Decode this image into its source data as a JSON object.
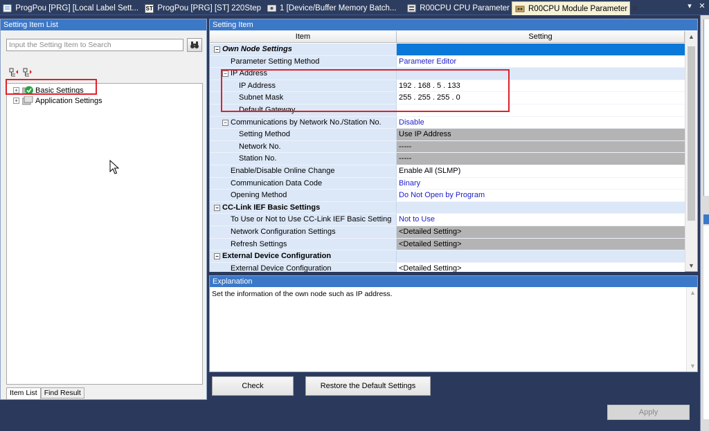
{
  "tabs": [
    {
      "label": "ProgPou [PRG] [Local Label Sett...",
      "icon": "ladder-program-icon"
    },
    {
      "label": "ProgPou [PRG] [ST] 220Step",
      "icon": "st-program-icon",
      "icon_text": "ST"
    },
    {
      "label": "1 [Device/Buffer Memory Batch...",
      "icon": "device-monitor-icon"
    },
    {
      "label": "R00CPU CPU Parameter",
      "icon": "parameter-icon"
    },
    {
      "label": "R00CPU Module Parameter",
      "icon": "module-parameter-icon",
      "active": true
    }
  ],
  "left_pane": {
    "title": "Setting Item List",
    "search_placeholder": "Input the Setting Item to Search",
    "tree": [
      {
        "label": "Basic Settings",
        "expander": "+"
      },
      {
        "label": "Application Settings",
        "expander": "+"
      }
    ],
    "bottom_tabs": [
      "Item List",
      "Find Result"
    ]
  },
  "setting_pane": {
    "title": "Setting Item",
    "columns": [
      "Item",
      "Setting"
    ],
    "rows": [
      {
        "item": "Own Node Settings",
        "setting": "",
        "kind": "section-italic",
        "indent": 0,
        "expander": "−",
        "style": "hdrblue"
      },
      {
        "item": "Parameter Setting Method",
        "setting": "Parameter Editor",
        "indent": 1,
        "style": "blue"
      },
      {
        "item": "IP Address",
        "setting": "",
        "indent": 1,
        "expander": "−",
        "style": "section"
      },
      {
        "item": "IP Address",
        "setting": "192 . 168 .   5 . 133",
        "indent": 2,
        "style": ""
      },
      {
        "item": "Subnet Mask",
        "setting": "255 . 255 . 255 .   0",
        "indent": 2,
        "style": ""
      },
      {
        "item": "Default Gateway",
        "setting": "",
        "indent": 2,
        "style": ""
      },
      {
        "item": "Communications by Network No./Station No.",
        "setting": "Disable",
        "indent": 1,
        "expander": "−",
        "style": "blue"
      },
      {
        "item": "Setting Method",
        "setting": "Use IP Address",
        "indent": 2,
        "style": "gray"
      },
      {
        "item": "Network No.",
        "setting": "-----",
        "indent": 2,
        "style": "gray"
      },
      {
        "item": "Station No.",
        "setting": "-----",
        "indent": 2,
        "style": "gray"
      },
      {
        "item": "Enable/Disable Online Change",
        "setting": "Enable All (SLMP)",
        "indent": 1,
        "style": ""
      },
      {
        "item": "Communication Data Code",
        "setting": "Binary",
        "indent": 1,
        "style": "blue"
      },
      {
        "item": "Opening Method",
        "setting": "Do Not Open by Program",
        "indent": 1,
        "style": "blue"
      },
      {
        "item": "CC-Link IEF Basic Settings",
        "setting": "",
        "kind": "section",
        "indent": 0,
        "expander": "−",
        "style": "section"
      },
      {
        "item": "To Use or Not to Use CC-Link IEF Basic Setting",
        "setting": "Not to Use",
        "indent": 1,
        "style": "blue"
      },
      {
        "item": "Network Configuration Settings",
        "setting": "<Detailed Setting>",
        "indent": 1,
        "style": "gray"
      },
      {
        "item": "Refresh Settings",
        "setting": "<Detailed Setting>",
        "indent": 1,
        "style": "gray"
      },
      {
        "item": "External Device Configuration",
        "setting": "",
        "kind": "section",
        "indent": 0,
        "expander": "−",
        "style": "section"
      },
      {
        "item": "External Device Configuration",
        "setting": "<Detailed Setting>",
        "indent": 1,
        "style": ""
      }
    ]
  },
  "explanation": {
    "title": "Explanation",
    "text": "Set the information of the own node such as IP address."
  },
  "buttons": {
    "check": "Check",
    "restore": "Restore the Default Settings",
    "apply": "Apply"
  },
  "colors": {
    "header_blue": "#3c78c8",
    "item_column": "#dce8f7",
    "link_blue": "#1c1cc8",
    "disabled_gray": "#b4b4b4",
    "highlight_red": "#e0202a"
  }
}
